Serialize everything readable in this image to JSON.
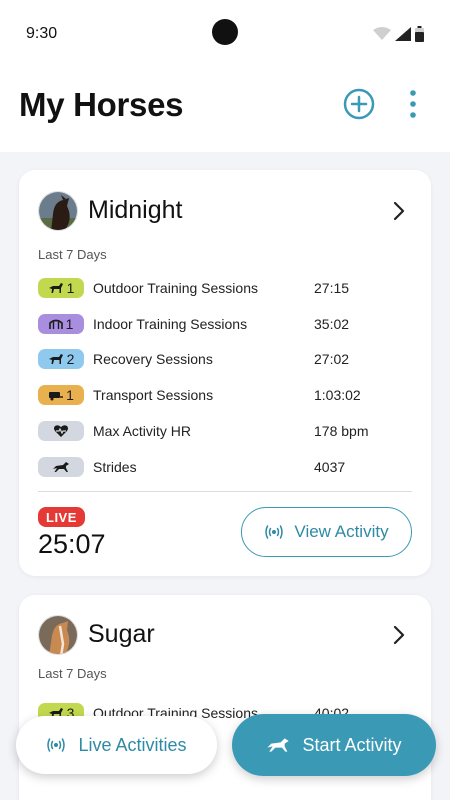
{
  "status_bar": {
    "time": "9:30"
  },
  "header": {
    "title": "My Horses"
  },
  "colors": {
    "accent": "#3a9ab5",
    "outdoor": "#c2d94f",
    "indoor": "#a98ee0",
    "recovery": "#8fc9ee",
    "transport": "#e8b04f",
    "neutral_pill": "#d3d8e0",
    "live": "#e53935"
  },
  "horses": [
    {
      "name": "Midnight",
      "period_label": "Last 7 Days",
      "stats": [
        {
          "icon": "horse-icon",
          "count": "1",
          "label": "Outdoor Training Sessions",
          "value": "27:15"
        },
        {
          "icon": "arena-icon",
          "count": "1",
          "label": "Indoor Training Sessions",
          "value": "35:02"
        },
        {
          "icon": "horse-icon",
          "count": "2",
          "label": "Recovery Sessions",
          "value": "27:02"
        },
        {
          "icon": "trailer-icon",
          "count": "1",
          "label": "Transport Sessions",
          "value": "1:03:02"
        },
        {
          "icon": "heart-rate-icon",
          "count": "",
          "label": "Max Activity HR",
          "value": "178 bpm"
        },
        {
          "icon": "horse-icon",
          "count": "",
          "label": "Strides",
          "value": "4037"
        }
      ],
      "live_badge": "LIVE",
      "live_timer": "25:07",
      "view_activity_label": "View Activity"
    },
    {
      "name": "Sugar",
      "period_label": "Last 7 Days",
      "stats": [
        {
          "icon": "horse-icon",
          "count": "3",
          "label": "Outdoor Training Sessions",
          "value": "40:02"
        }
      ]
    }
  ],
  "bottom_bar": {
    "live_activities_label": "Live Activities",
    "start_activity_label": "Start Activity"
  }
}
